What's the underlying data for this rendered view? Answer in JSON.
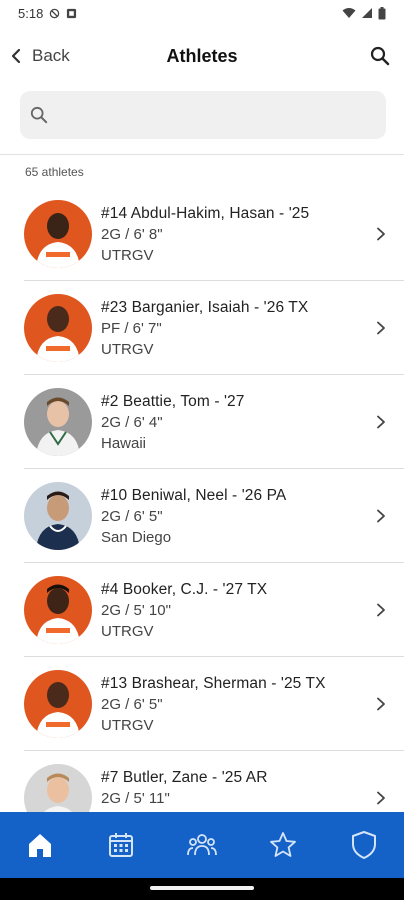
{
  "status_bar": {
    "time": "5:18"
  },
  "app_bar": {
    "back_label": "Back",
    "title": "Athletes"
  },
  "search": {
    "value": "",
    "placeholder": ""
  },
  "count_label": "65 athletes",
  "athletes": [
    {
      "name": "#14 Abdul-Hakim, Hasan - '25",
      "position": "2G / 6' 8\"",
      "school": "UTRGV",
      "jersey_color": "#f06a2c"
    },
    {
      "name": "#23 Barganier, Isaiah - '26 TX",
      "position": "PF / 6' 7\"",
      "school": "UTRGV",
      "jersey_color": "#f06a2c"
    },
    {
      "name": "#2 Beattie, Tom - '27",
      "position": "2G / 6' 4\"",
      "school": "Hawaii",
      "jersey_color": "#c8c8c8"
    },
    {
      "name": "#10 Beniwal, Neel - '26 PA",
      "position": "2G / 6' 5\"",
      "school": "San Diego",
      "jersey_color": "#8aa0b8"
    },
    {
      "name": "#4 Booker, C.J. - '27 TX",
      "position": "2G / 5' 10\"",
      "school": "UTRGV",
      "jersey_color": "#f06a2c"
    },
    {
      "name": "#13 Brashear, Sherman - '25 TX",
      "position": "2G / 6' 5\"",
      "school": "UTRGV",
      "jersey_color": "#f06a2c"
    },
    {
      "name": "#7 Butler, Zane - '25 AR",
      "position": "2G / 5' 11\"",
      "school": "",
      "jersey_color": "#d8d8d8"
    }
  ],
  "bottom_nav": [
    "home-icon",
    "calendar-icon",
    "team-icon",
    "star-icon",
    "shield-icon"
  ],
  "colors": {
    "nav_blue": "#1462c8",
    "nav_active": "#ffffff",
    "nav_inactive": "#cfe0f7"
  }
}
